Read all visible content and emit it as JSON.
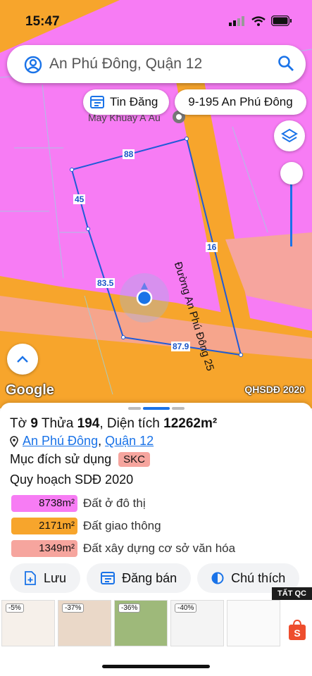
{
  "status_bar": {
    "time": "15:47"
  },
  "search": {
    "text": "An Phú Đông, Quận 12"
  },
  "map_pills": {
    "tin_dang": "Tin Đăng",
    "address": "9-195 An Phú Đông"
  },
  "map": {
    "poi_label": "May Khuay A Âu",
    "road_name": "Đường An Phú Đông 25",
    "dims": {
      "top": "88",
      "left": "45",
      "mid": "83.5",
      "bottom": "87.9",
      "right": "16"
    },
    "google_label": "Google",
    "layer_label": "QHSDĐ 2020",
    "colors": {
      "residential": "#f77cf4",
      "road": "#f7a52c",
      "culture": "#f6a59e",
      "boundary": "#1f5bd8"
    }
  },
  "panel": {
    "title_prefix": "Tờ ",
    "sheet": "9",
    "lot_prefix": " Thửa ",
    "lot": "194",
    "area_prefix": ", Diện tích ",
    "area": "12262m²",
    "location_ward": "An Phú Đông",
    "location_sep": ", ",
    "location_district": "Quận 12",
    "purpose_label": "Mục đích sử dụng",
    "purpose_badge": "SKC",
    "plan_label": "Quy hoạch SDĐ 2020",
    "legend": [
      {
        "value": "8738m²",
        "name": "Đất ở đô thị",
        "color": "#f77cf4"
      },
      {
        "value": "2171m²",
        "name": "Đất giao thông",
        "color": "#f7a52c"
      },
      {
        "value": "1349m²",
        "name": "Đất xây dựng cơ sở văn hóa",
        "color": "#f6a59e"
      }
    ],
    "actions": {
      "save": "Lưu",
      "post": "Đăng bán",
      "legend": "Chú thích"
    }
  },
  "ads": {
    "label": "TẤT QC",
    "discounts": [
      "-5%",
      "-37%",
      "-36%",
      "-40%"
    ]
  }
}
